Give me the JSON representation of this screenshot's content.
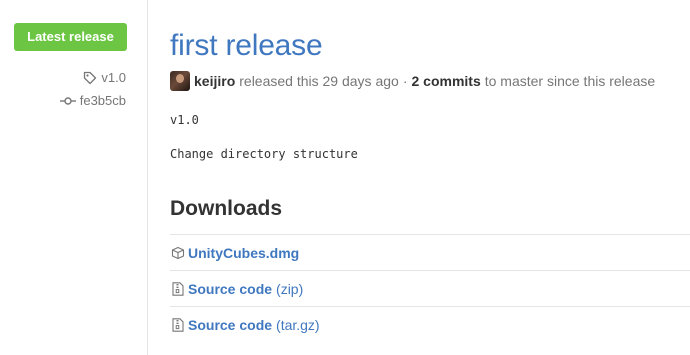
{
  "sidebar": {
    "latest_label": "Latest release",
    "tag": "v1.0",
    "commit": "fe3b5cb"
  },
  "release": {
    "title": "first release",
    "author": "keijiro",
    "released_text": "released this 29 days ago",
    "separator": "·",
    "commits_label": "2 commits",
    "commits_suffix": "to master since this release",
    "version_text": "v1.0",
    "description": "Change directory structure"
  },
  "downloads": {
    "heading": "Downloads",
    "items": [
      {
        "name": "UnityCubes.dmg",
        "ext": "",
        "icon": "package-icon"
      },
      {
        "name": "Source code",
        "ext": "(zip)",
        "icon": "file-zip-icon"
      },
      {
        "name": "Source code",
        "ext": "(tar.gz)",
        "icon": "file-zip-icon"
      }
    ]
  },
  "colors": {
    "accent": "#4078c0",
    "badge": "#6cc644",
    "muted": "#767676",
    "border": "#e5e5e5"
  }
}
